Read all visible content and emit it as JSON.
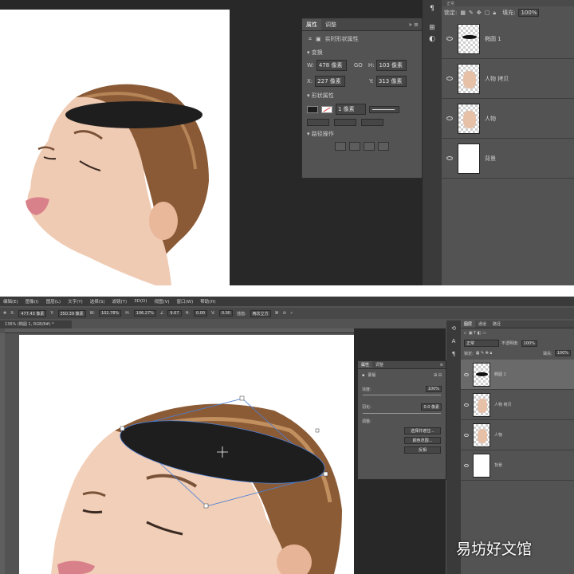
{
  "top": {
    "properties_panel": {
      "tabs": [
        "属性",
        "调整"
      ],
      "header": "实时形状属性",
      "section_transform": "变换",
      "w_label": "W:",
      "w_value": "478 像素",
      "go_label": "GO",
      "h_label": "H:",
      "h_value": "103 像素",
      "x_label": "X:",
      "x_value": "227 像素",
      "y_label": "Y:",
      "y_value": "313 像素",
      "section_appearance": "形状属性",
      "stroke_width": "1 像素",
      "section_path_ops": "路径操作"
    },
    "layers": {
      "blend_mode": "正常",
      "lock_label": "锁定:",
      "fill_label": "填充:",
      "fill_value": "100%",
      "items": [
        {
          "name": "椭圆 1"
        },
        {
          "name": "人物 拷贝"
        },
        {
          "name": "人物"
        },
        {
          "name": "背景"
        }
      ]
    }
  },
  "bottom": {
    "menubar": [
      "编辑(E)",
      "图像(I)",
      "图层(L)",
      "文字(Y)",
      "选择(S)",
      "滤镜(T)",
      "3D(D)",
      "视图(V)",
      "窗口(W)",
      "帮助(H)"
    ],
    "options": {
      "x_value": "477.43 像素",
      "y_value": "350.39 像素",
      "w_value": "102.78%",
      "h_value": "106.27%",
      "angle_value": "9.67",
      "h_skew": "0.00",
      "v_skew": "0.00",
      "interp_label": "插值:",
      "interp_value": "两次立方"
    },
    "doc_tab": "136% (椭圆 1, RGB/8#) *",
    "properties_panel": {
      "tabs": [
        "属性",
        "调整"
      ],
      "header": "蒙版",
      "density_label": "浓度:",
      "density_value": "100%",
      "feather_label": "羽化:",
      "feather_value": "0.0 像素",
      "refine_label": "调整:",
      "btn_edge": "选择并遮住...",
      "btn_color": "颜色范围...",
      "btn_invert": "反相"
    },
    "layers": {
      "tabs": [
        "图层",
        "通道",
        "路径"
      ],
      "blend_mode": "正常",
      "opacity_label": "不透明度:",
      "opacity_value": "100%",
      "lock_label": "锁定:",
      "fill_label": "填充:",
      "fill_value": "100%",
      "items": [
        {
          "name": "椭圆 1"
        },
        {
          "name": "人物 拷贝"
        },
        {
          "name": "人物"
        },
        {
          "name": "背景"
        }
      ]
    }
  },
  "watermark": "易坊好文馆"
}
